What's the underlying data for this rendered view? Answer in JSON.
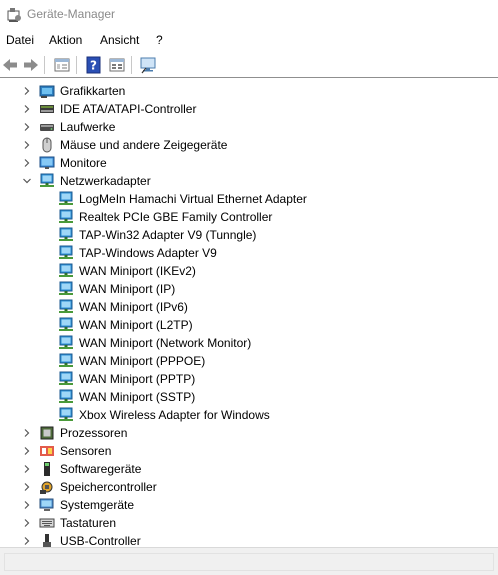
{
  "window": {
    "title": "Geräte-Manager"
  },
  "menu": [
    "Datei",
    "Aktion",
    "Ansicht",
    "?"
  ],
  "toolbar": {
    "buttons": [
      "back-arrow-icon",
      "forward-arrow-icon",
      "properties-icon",
      "help-icon",
      "view-icon",
      "scan-hardware-icon"
    ]
  },
  "tree": {
    "categories": [
      {
        "label": "Grafikkarten",
        "icon": "display-adapter-icon",
        "expanded": false
      },
      {
        "label": "IDE ATA/ATAPI-Controller",
        "icon": "ide-controller-icon",
        "expanded": false
      },
      {
        "label": "Laufwerke",
        "icon": "disk-drive-icon",
        "expanded": false
      },
      {
        "label": "Mäuse und andere Zeigegeräte",
        "icon": "mouse-icon",
        "expanded": false
      },
      {
        "label": "Monitore",
        "icon": "monitor-icon",
        "expanded": false
      },
      {
        "label": "Netzwerkadapter",
        "icon": "network-adapter-icon",
        "expanded": true,
        "children": [
          "LogMeIn Hamachi Virtual Ethernet Adapter",
          "Realtek PCIe GBE Family Controller",
          "TAP-Win32 Adapter V9 (Tunngle)",
          "TAP-Windows Adapter V9",
          "WAN Miniport (IKEv2)",
          "WAN Miniport (IP)",
          "WAN Miniport (IPv6)",
          "WAN Miniport (L2TP)",
          "WAN Miniport (Network Monitor)",
          "WAN Miniport (PPPOE)",
          "WAN Miniport (PPTP)",
          "WAN Miniport (SSTP)",
          "Xbox Wireless Adapter for Windows"
        ]
      },
      {
        "label": "Prozessoren",
        "icon": "processor-icon",
        "expanded": false
      },
      {
        "label": "Sensoren",
        "icon": "sensor-icon",
        "expanded": false
      },
      {
        "label": "Softwaregeräte",
        "icon": "software-device-icon",
        "expanded": false
      },
      {
        "label": "Speichercontroller",
        "icon": "storage-controller-icon",
        "expanded": false
      },
      {
        "label": "Systemgeräte",
        "icon": "system-device-icon",
        "expanded": false
      },
      {
        "label": "Tastaturen",
        "icon": "keyboard-icon",
        "expanded": false
      },
      {
        "label": "USB-Controller",
        "icon": "usb-controller-icon",
        "expanded": false
      }
    ]
  },
  "colors": {
    "title_gray": "#8a8a8a",
    "network_blue": "#2b8fd6",
    "separator": "#8f8f8f"
  }
}
